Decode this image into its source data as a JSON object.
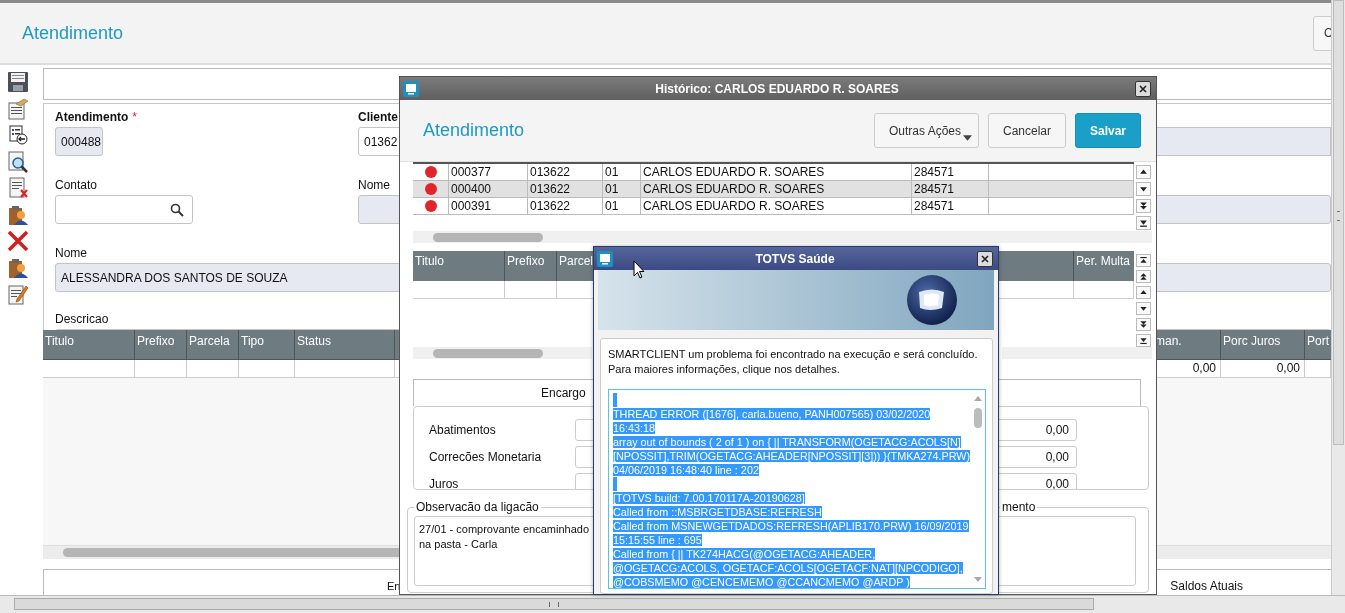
{
  "app": {
    "title": "Atendimento",
    "corner_button": "C"
  },
  "form": {
    "atendimento": {
      "label": "Atendimento",
      "required_mark": "*",
      "value": "000488"
    },
    "cliente": {
      "label": "Cliente",
      "value": "01362"
    },
    "contato": {
      "label": "Contato"
    },
    "nome_cliente": {
      "label": "Nome"
    },
    "nome": {
      "label": "Nome",
      "value": "ALESSANDRA DOS SANTOS DE SOUZA"
    },
    "descricao": {
      "label": "Descricao"
    }
  },
  "table": {
    "columns": [
      "Titulo",
      "Prefixo",
      "Parcela",
      "Tipo",
      "Status"
    ],
    "right_columns": [
      "man.",
      "Porc Juros",
      "Port"
    ],
    "row_values": [
      "0,00",
      "0,00"
    ]
  },
  "bottom_tabs": [
    "En",
    "Saldos Atuais"
  ],
  "historico": {
    "title": "Histórico: CARLOS EDUARDO R. SOARES",
    "heading": "Atendimento",
    "buttons": [
      {
        "label": "Outras Ações",
        "kind": "menu"
      },
      {
        "label": "Cancelar",
        "kind": "default"
      },
      {
        "label": "Salvar",
        "kind": "primary"
      }
    ],
    "rows": [
      {
        "color": "#e0262b",
        "selected": false,
        "cells": [
          "000377",
          "013622",
          "01",
          "CARLOS EDUARDO R. SOARES",
          "284571"
        ]
      },
      {
        "color": "#e0262b",
        "selected": true,
        "cells": [
          "000400",
          "013622",
          "01",
          "CARLOS EDUARDO R. SOARES",
          "284571"
        ]
      },
      {
        "color": "#e0262b",
        "selected": false,
        "cells": [
          "000391",
          "013622",
          "01",
          "CARLOS EDUARDO R. SOARES",
          "284571"
        ]
      }
    ],
    "grid2_columns": [
      "Titulo",
      "Prefixo",
      "Parcel"
    ],
    "grid2_right_column": "Per. Multa",
    "tab": "Encargo",
    "fields": [
      {
        "label": "Abatimentos",
        "value": "0,00"
      },
      {
        "label": "Correcões Monetaria",
        "value": "0,00"
      },
      {
        "label": "Juros",
        "value": "0,00"
      }
    ],
    "observacao": {
      "legend": "Observacão da ligacão",
      "lines": [
        "27/01 - comprovante encaminhado",
        "na pasta - Carla"
      ]
    },
    "right_group": {
      "legend": "mento"
    }
  },
  "error_dialog": {
    "title": "TOTVS Saúde",
    "message": [
      "SMARTCLIENT um problema foi encontrado na execução e será concluído.",
      "Para maiores informações, clique nos detalhes."
    ],
    "details": [
      [
        "THREAD ERROR ([1676], carla.bueno, PANH007565)   03/02/2020",
        "16:43:18",
        "array out of bounds ( 2 of 1 )  on { || TRANSFORM(OGETACG:ACOLS[N]",
        "[NPOSSIT],TRIM(OGETACG:AHEADER[NPOSSIT][3]))  }(TMKA274.PRW)",
        "04/06/2019 16:48:40 line : 202"
      ],
      [
        "[TOTVS build: 7.00.170117A-20190628]",
        "Called from ::MSBRGETDBASE:REFRESH",
        "Called from MSNEWGETDADOS:REFRESH(APLIB170.PRW) 16/09/2019",
        "15:15:55 line : 695",
        "Called from { || TK274HACG(@OGETACG:AHEADER,",
        "@OGETACG:ACOLS, OGETACF:ACOLS[OGETACF:NAT][NPCODIGO],",
        "@COBSMEMO  @CENCEMEMO  @CCANCMEMO  @ARDP )"
      ]
    ]
  }
}
